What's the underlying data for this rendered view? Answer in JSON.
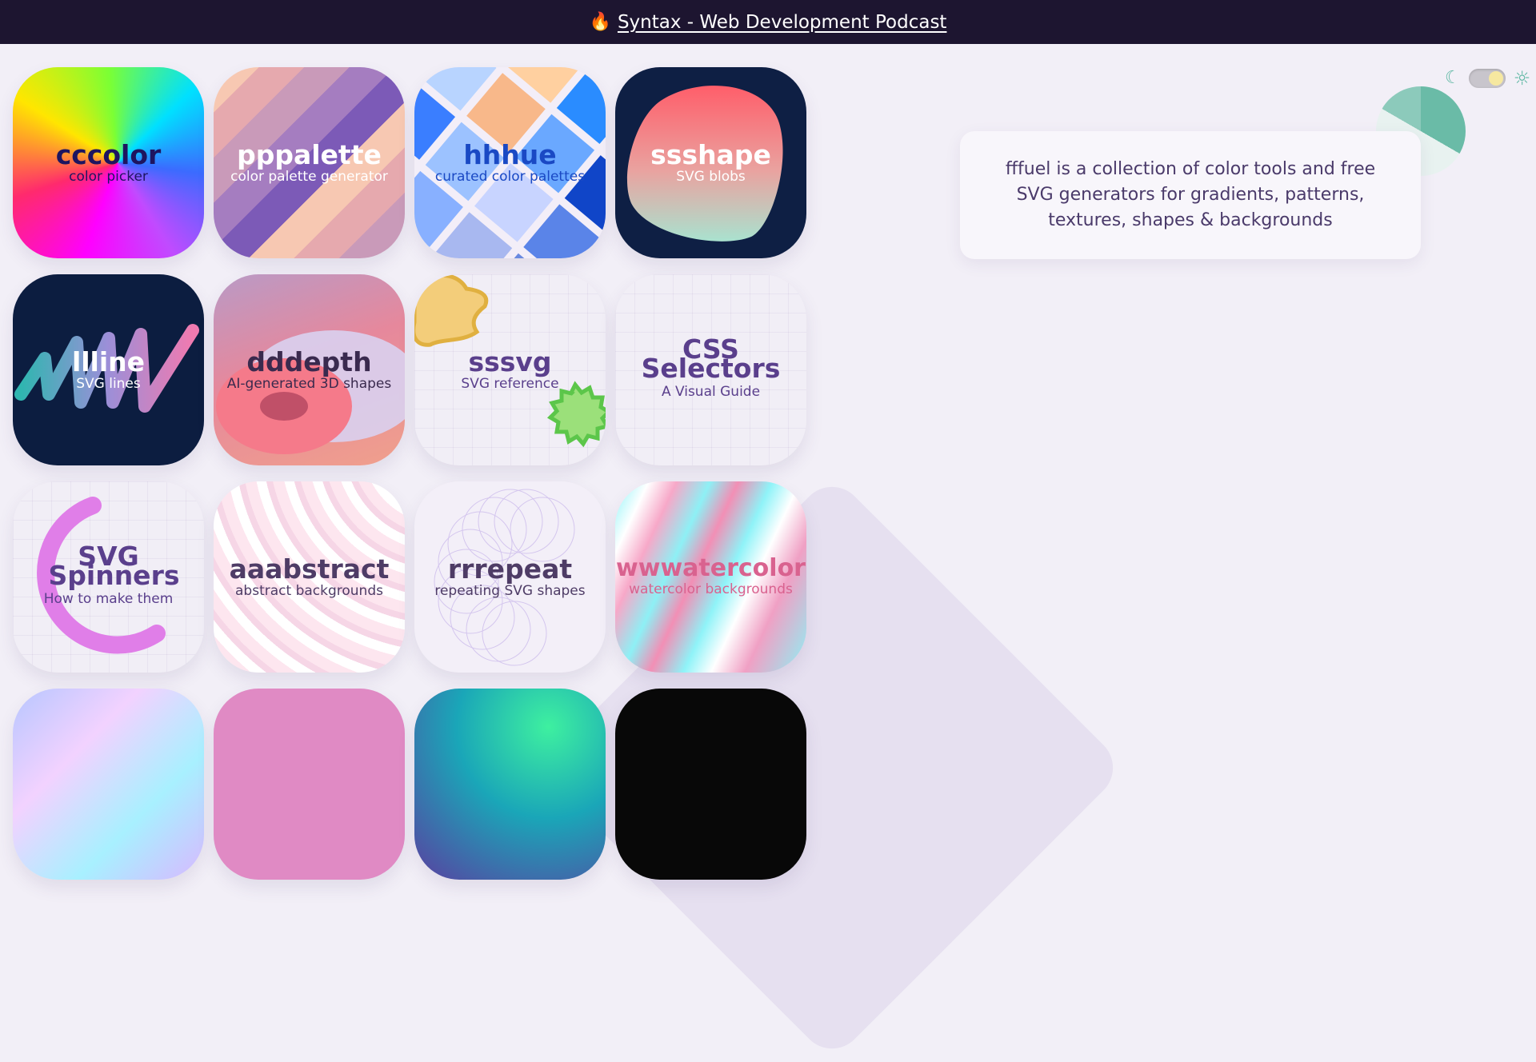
{
  "topbar": {
    "fire_icon": "🔥",
    "link_text": "Syntax - Web Development Podcast"
  },
  "intro": {
    "text": "fffuel is a collection of color tools and free SVG generators for gradients, patterns, textures, shapes & backgrounds"
  },
  "theme_toggle": {
    "moon_icon": "☾",
    "sun_icon": "☼",
    "state": "light"
  },
  "tiles": [
    {
      "title": "cccolor",
      "subtitle": "color picker",
      "text_color": "#1e1560"
    },
    {
      "title": "pppalette",
      "subtitle": "color palette generator",
      "text_color": "#ffffff"
    },
    {
      "title": "hhhue",
      "subtitle": "curated color palettes",
      "text_color": "#1a49c4"
    },
    {
      "title": "ssshape",
      "subtitle": "SVG blobs",
      "text_color": "#ffffff"
    },
    {
      "title": "llline",
      "subtitle": "SVG lines",
      "text_color": "#ffffff"
    },
    {
      "title": "dddepth",
      "subtitle": "AI-generated 3D shapes",
      "text_color": "#3a2a4e"
    },
    {
      "title": "sssvg",
      "subtitle": "SVG reference",
      "text_color": "#5a3f8c"
    },
    {
      "title": "CSS Selectors",
      "subtitle": "A Visual Guide",
      "text_color": "#5a3f8c"
    },
    {
      "title": "SVG Spinners",
      "subtitle": "How to make them",
      "text_color": "#5a3f8c"
    },
    {
      "title": "aaabstract",
      "subtitle": "abstract backgrounds",
      "text_color": "#4e3c66"
    },
    {
      "title": "rrrepeat",
      "subtitle": "repeating SVG shapes",
      "text_color": "#4e3c66"
    },
    {
      "title": "wwwatercolor",
      "subtitle": "watercolor backgrounds",
      "text_color": "#d9628f"
    },
    {
      "title": "",
      "subtitle": ""
    },
    {
      "title": "",
      "subtitle": ""
    },
    {
      "title": "",
      "subtitle": ""
    },
    {
      "title": "",
      "subtitle": ""
    }
  ]
}
